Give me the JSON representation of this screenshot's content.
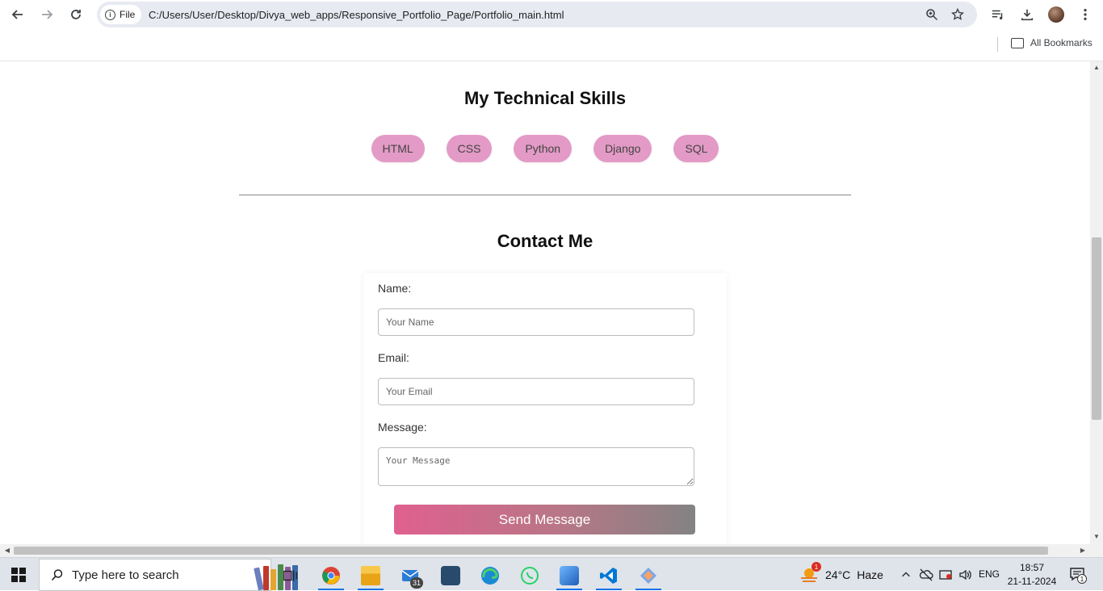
{
  "browser": {
    "site_chip_label": "File",
    "url": "C:/Users/User/Desktop/Divya_web_apps/Responsive_Portfolio_Page/Portfolio_main.html",
    "bookmarks_label": "All Bookmarks"
  },
  "skills": {
    "title": "My Technical Skills",
    "items": [
      "HTML",
      "CSS",
      "Python",
      "Django",
      "SQL"
    ]
  },
  "contact": {
    "title": "Contact Me",
    "name_label": "Name:",
    "name_placeholder": "Your Name",
    "email_label": "Email:",
    "email_placeholder": "Your Email",
    "message_label": "Message:",
    "message_placeholder": "Your Message",
    "submit_label": "Send Message"
  },
  "taskbar": {
    "search_placeholder": "Type here to search",
    "mail_badge": "31",
    "weather_temp": "24°C",
    "weather_desc": "Haze",
    "weather_badge": "1",
    "language": "ENG",
    "time": "18:57",
    "date": "21-11-2024",
    "notification_count": "1"
  },
  "colors": {
    "skill_pill": "#e39ac6",
    "button_gradient_start": "#e0608f",
    "button_gradient_end": "#838383",
    "taskbar_bg": "#dfe3ea"
  }
}
